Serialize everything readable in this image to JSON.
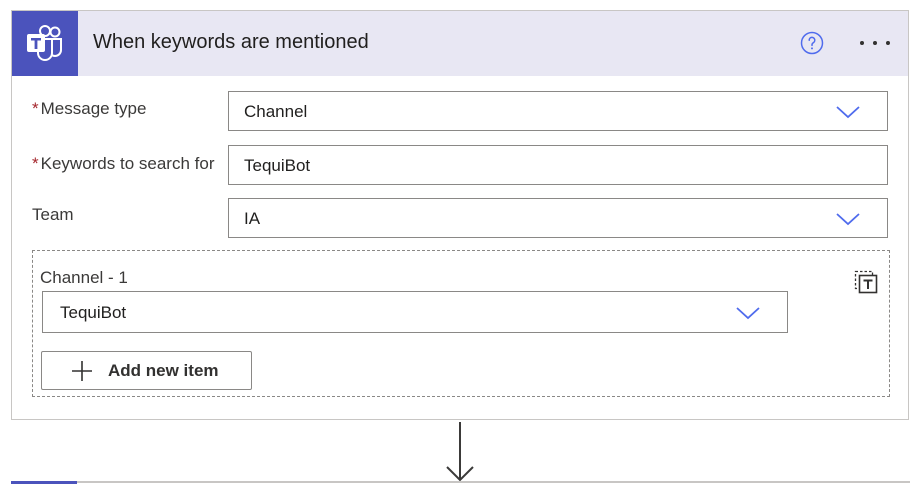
{
  "trigger": {
    "title": "When keywords are mentioned",
    "logo_icon": "microsoft-teams-icon",
    "help_icon": "help-circle-icon",
    "more_icon": "more-options-icon",
    "accent_color": "#4b53bc",
    "header_bg": "#e8e7f3"
  },
  "fields": {
    "message_type": {
      "required_mark": "*",
      "label": "Message type",
      "value": "Channel"
    },
    "keywords": {
      "required_mark": "*",
      "label": "Keywords to search for",
      "value": "TequiBot"
    },
    "team": {
      "label": "Team",
      "value": "IA"
    }
  },
  "channel_section": {
    "label": "Channel - 1",
    "value": "TequiBot",
    "delete_icon": "delete-item-icon",
    "add_button_label": "Add new item"
  },
  "chevron_color": "#4f6bed"
}
